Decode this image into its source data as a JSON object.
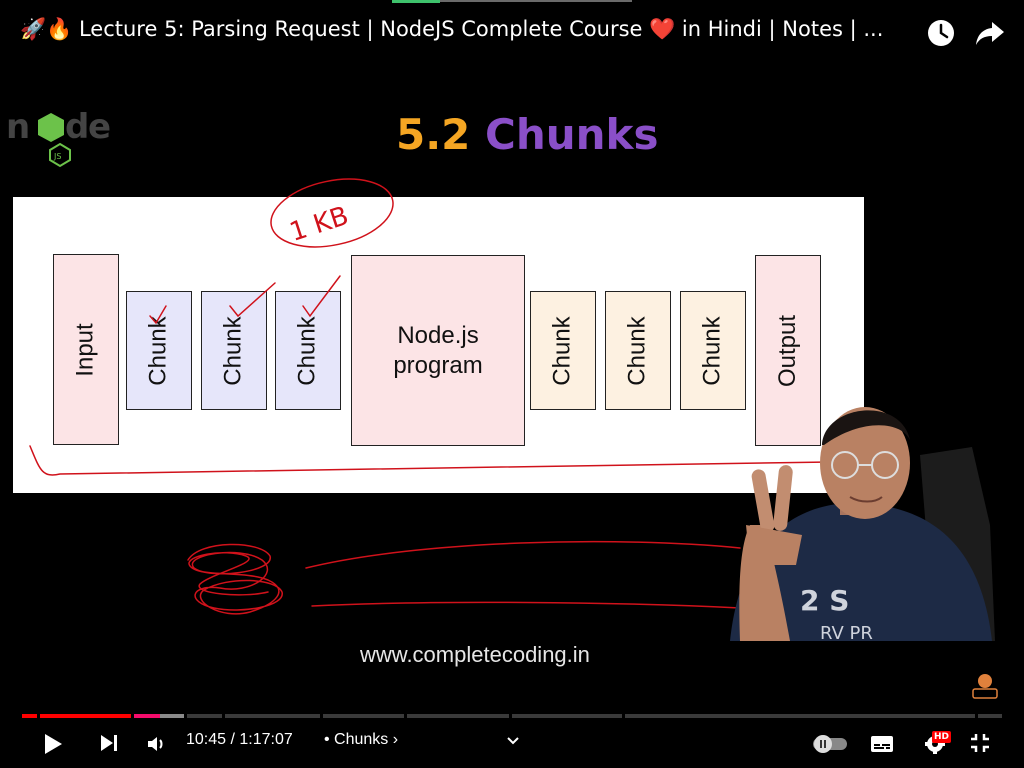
{
  "header": {
    "title": "🚀🔥 Lecture 5: Parsing Request | NodeJS Complete Course ❤️  in Hindi | Notes | ..."
  },
  "slide": {
    "heading_number": "5.2",
    "heading_word": "Chunks",
    "input_label": "Input",
    "chunk_label": "Chunk",
    "program_line1": "Node.js",
    "program_line2": "program",
    "output_label": "Output",
    "annotation": "1 KB",
    "url": "www.completecoding.in"
  },
  "controls": {
    "current_time": "10:45",
    "duration": "1:17:07",
    "chapter": "• Chunks ›",
    "quality_badge": "HD"
  },
  "progress": {
    "played_fraction": 0.114,
    "buffered_fraction": 0.165
  },
  "colors": {
    "accent_red": "#ff0000",
    "heading_orange": "#f5a623",
    "heading_purple": "#8a4fc8",
    "ink_red": "#d0121b"
  },
  "icons": [
    "clock-icon",
    "share-icon",
    "play-icon",
    "next-icon",
    "volume-icon",
    "chevron-down-icon",
    "autoplay-toggle-icon",
    "subtitles-icon",
    "settings-icon",
    "exit-fullscreen-icon"
  ]
}
